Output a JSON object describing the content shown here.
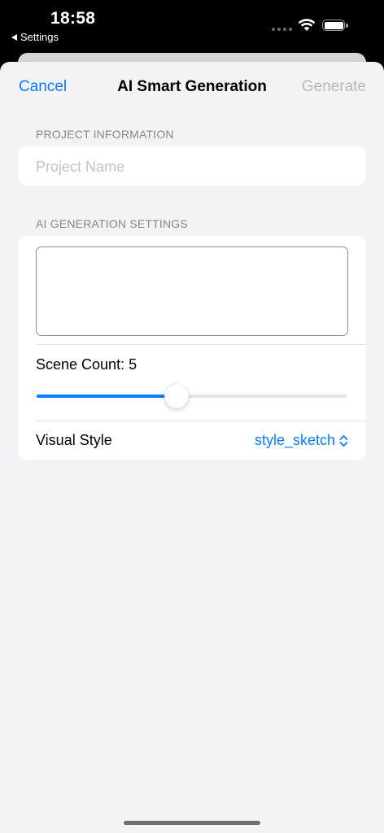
{
  "status_bar": {
    "time": "18:58",
    "back_label": "Settings"
  },
  "nav": {
    "cancel_label": "Cancel",
    "title": "AI Smart Generation",
    "generate_label": "Generate"
  },
  "project_section": {
    "header": "PROJECT INFORMATION",
    "name_placeholder": "Project Name",
    "name_value": ""
  },
  "ai_section": {
    "header": "AI GENERATION SETTINGS",
    "prompt_value": "",
    "scene_count_label": "Scene Count: 5",
    "scene_count_fraction": 0.45,
    "visual_style_label": "Visual Style",
    "visual_style_value": "style_sketch"
  },
  "colors": {
    "accent": "#0a7aff",
    "disabled": "#b7b7bb",
    "background": "#f2f2f7"
  },
  "icons": [
    "back-triangle-icon",
    "wifi-icon",
    "battery-icon",
    "chevron-up-down-icon"
  ]
}
